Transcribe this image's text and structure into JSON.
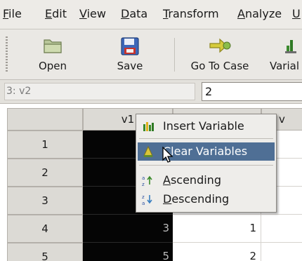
{
  "menubar": {
    "items": [
      {
        "acc": "F",
        "rest": "ile"
      },
      {
        "acc": "E",
        "rest": "dit"
      },
      {
        "acc": "V",
        "rest": "iew"
      },
      {
        "acc": "D",
        "rest": "ata"
      },
      {
        "acc": "T",
        "rest": "ransform"
      },
      {
        "acc": "A",
        "rest": "nalyze"
      },
      {
        "acc": "U",
        "rest": ""
      }
    ]
  },
  "toolbar": {
    "open_label": "Open",
    "save_label": "Save",
    "goto_label": "Go To Case",
    "variables_label": "Varial",
    "icons": {
      "open": "folder-open-icon",
      "save": "floppy-disk-icon",
      "goto": "arrow-right-icon",
      "variables": "variables-icon"
    }
  },
  "cellbar": {
    "reference": "3: v2",
    "value": "2"
  },
  "grid": {
    "columns": [
      "v1",
      "",
      "v"
    ],
    "rows": [
      {
        "number": "1",
        "v1": "",
        "v2": ""
      },
      {
        "number": "2",
        "v1": "",
        "v2": ""
      },
      {
        "number": "3",
        "v1": "",
        "v2": ""
      },
      {
        "number": "4",
        "v1": "3",
        "v2": "1"
      },
      {
        "number": "5",
        "v1": "5",
        "v2": "2"
      }
    ]
  },
  "context_menu": {
    "items": [
      {
        "label": "Insert Variable",
        "icon": "insert-variable-icon",
        "acc": "",
        "rest": "Insert Variable"
      },
      {
        "label": "Clear Variables",
        "icon": "clear-variables-icon",
        "acc": "",
        "rest": "Clear Variables",
        "active": true
      },
      {
        "label": "Ascending",
        "icon": "sort-ascending-icon",
        "acc": "A",
        "rest": "scending"
      },
      {
        "label": "Descending",
        "icon": "sort-descending-icon",
        "acc": "D",
        "rest": "escending"
      }
    ]
  },
  "colors": {
    "menu_highlight": "#4f6f95",
    "selected_column": "#050505",
    "header_bg": "#dcdad5"
  }
}
